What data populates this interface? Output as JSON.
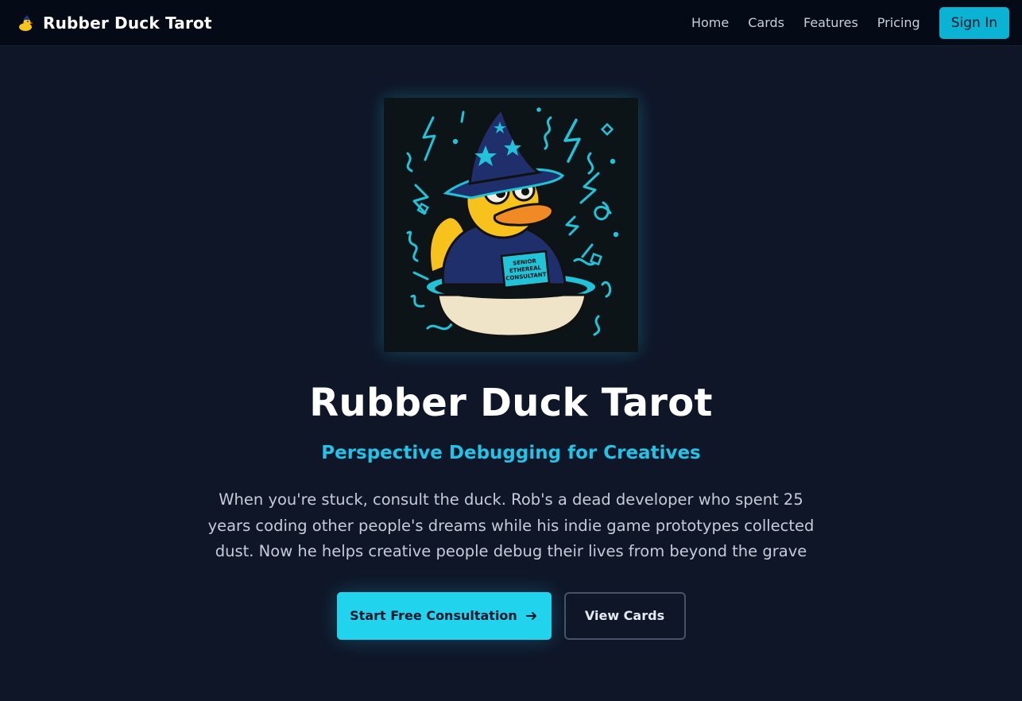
{
  "nav": {
    "brand_icon": "wizard-duck-icon",
    "brand": "Rubber Duck Tarot",
    "links": [
      "Home",
      "Cards",
      "Features",
      "Pricing"
    ],
    "signin": "Sign In"
  },
  "hero": {
    "image": {
      "description_icon": "wizard-rubber-duck-illustration",
      "badge_lines": [
        "SENIOR",
        "ETHEREAL",
        "CONSULTANT"
      ]
    },
    "title": "Rubber Duck Tarot",
    "subtitle": "Perspective Debugging for Creatives",
    "description": "When you're stuck, consult the duck. Rob's a dead developer who spent 25 years coding other people's dreams while his indie game prototypes collected dust. Now he helps creative people debug their lives from beyond the grave",
    "primary_cta": "Start Free Consultation",
    "primary_cta_icon": "arrow-right-icon",
    "secondary_cta": "View Cards"
  },
  "colors": {
    "background": "#0f1628",
    "navbar": "#050a17",
    "accent": "#22d3ee",
    "subtitle": "#22c3e6",
    "signin": "#0ab2d3"
  }
}
